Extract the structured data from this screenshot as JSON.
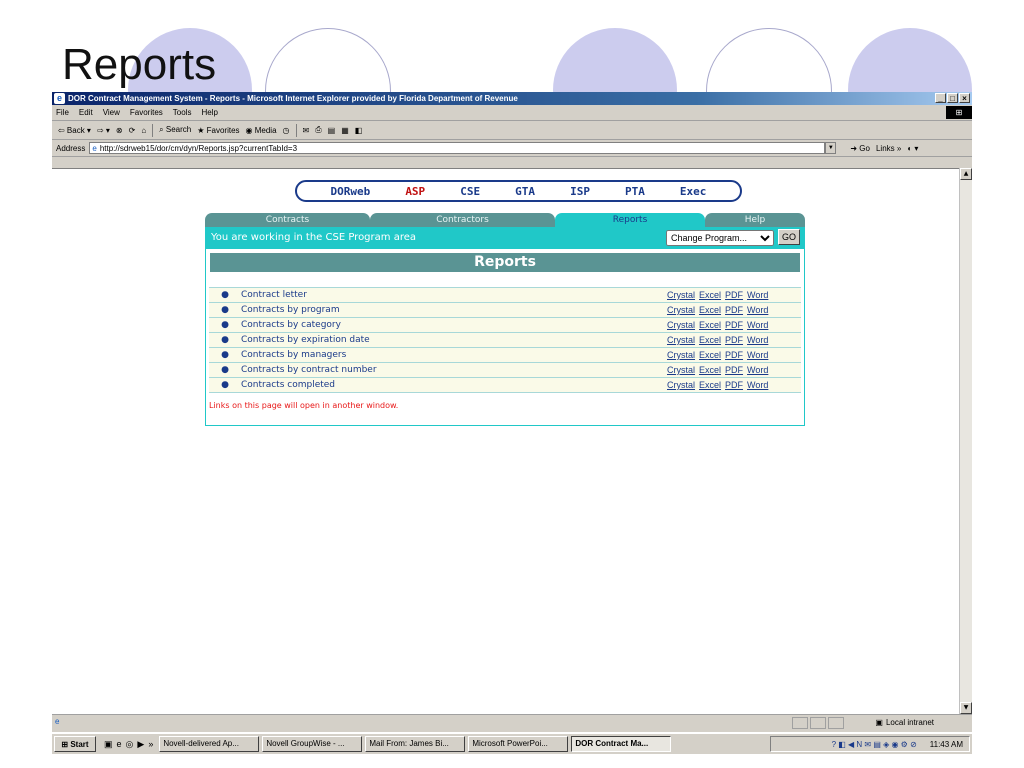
{
  "slide": {
    "title": "Reports"
  },
  "window": {
    "title": "DOR Contract Management System - Reports - Microsoft Internet Explorer provided by Florida Department of Revenue",
    "controls": [
      "_",
      "□",
      "×"
    ]
  },
  "menu": [
    "File",
    "Edit",
    "View",
    "Favorites",
    "Tools",
    "Help"
  ],
  "toolbar": {
    "back": "⇦ Back ▾",
    "forward": "⇨ ▾",
    "search": "Search",
    "favorites": "Favorites",
    "media": "Media"
  },
  "address": {
    "label": "Address",
    "url": "http://sdrweb15/dor/cm/dyn/Reports.jsp?currentTabId=3",
    "go": "Go",
    "links": "Links »"
  },
  "nav": [
    "DORweb",
    "ASP",
    "CSE",
    "GTA",
    "ISP",
    "PTA",
    "Exec"
  ],
  "tabs": [
    {
      "label": "Contracts"
    },
    {
      "label": "Contractors"
    },
    {
      "label": "Reports"
    },
    {
      "label": "Help"
    }
  ],
  "banner": {
    "text": "You are working in the CSE Program area",
    "select_value": "Change Program...",
    "go_label": "GO"
  },
  "panel": {
    "title": "Reports",
    "rows": [
      {
        "label": "Contract letter"
      },
      {
        "label": "Contracts by program"
      },
      {
        "label": "Contracts by category"
      },
      {
        "label": "Contracts by expiration date"
      },
      {
        "label": "Contracts by managers"
      },
      {
        "label": "Contracts by contract number"
      },
      {
        "label": "Contracts completed"
      }
    ],
    "formats": [
      "Crystal",
      "Excel",
      "PDF",
      "Word"
    ],
    "note": "Links on this page will open in another window."
  },
  "status": {
    "zone": "Local intranet"
  },
  "taskbar": {
    "start": "Start",
    "buttons": [
      "Novell-delivered Ap...",
      "Novell GroupWise - ...",
      "Mail From: James Bi...",
      "Microsoft PowerPoi...",
      "DOR Contract Ma..."
    ],
    "clock": "11:43 AM"
  }
}
